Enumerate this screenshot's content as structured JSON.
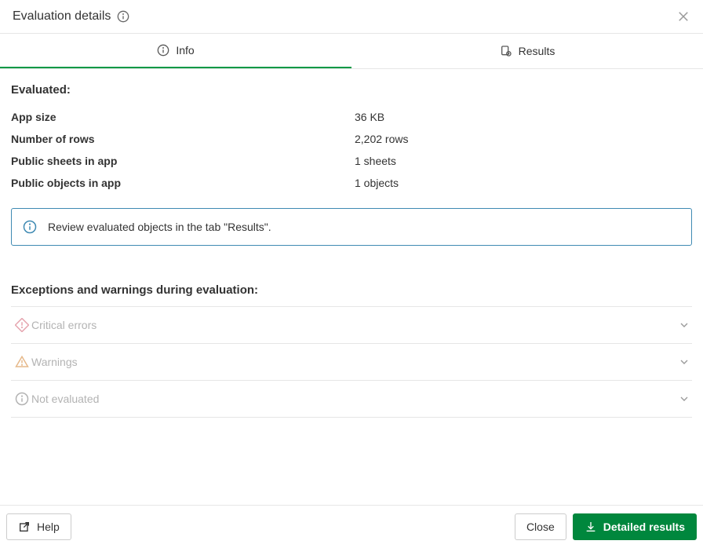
{
  "header": {
    "title": "Evaluation details"
  },
  "tabs": {
    "info": "Info",
    "results": "Results"
  },
  "evaluated": {
    "heading": "Evaluated:",
    "rows": [
      {
        "k": "App size",
        "v": "36 KB"
      },
      {
        "k": "Number of rows",
        "v": "2,202 rows"
      },
      {
        "k": "Public sheets in app",
        "v": "1 sheets"
      },
      {
        "k": "Public objects in app",
        "v": "1 objects"
      }
    ]
  },
  "callout": {
    "text": "Review evaluated objects in the tab \"Results\"."
  },
  "exceptions": {
    "heading": "Exceptions and warnings during evaluation:",
    "critical": "Critical errors",
    "warnings": "Warnings",
    "not_evaluated": "Not evaluated"
  },
  "footer": {
    "help": "Help",
    "close": "Close",
    "detailed": "Detailed results"
  }
}
